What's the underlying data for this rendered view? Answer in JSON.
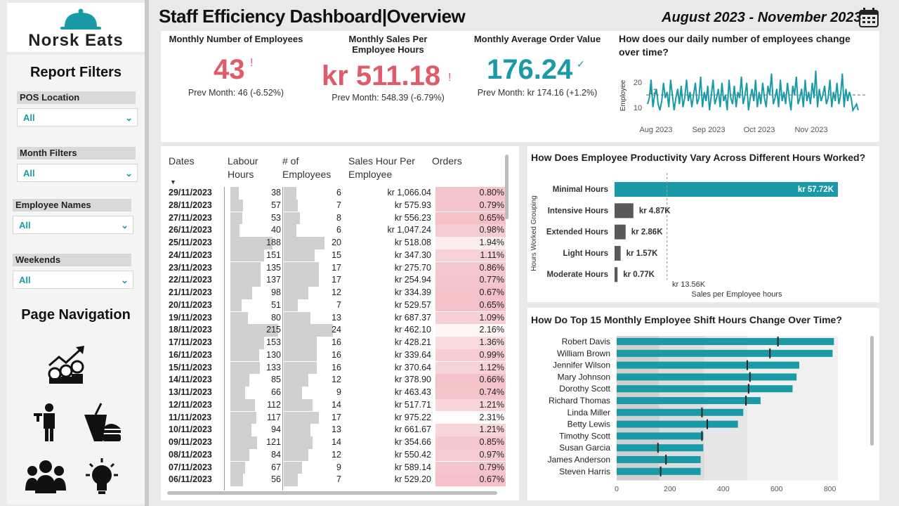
{
  "logo": {
    "brand": "Norsk Eats"
  },
  "sidebar": {
    "report_filters_title": "Report Filters",
    "filters": [
      {
        "label": "POS Location",
        "value": "All"
      },
      {
        "label": "Month Filters",
        "value": "All"
      },
      {
        "label": "Employee Names",
        "value": "All"
      },
      {
        "label": "Weekends",
        "value": "All"
      }
    ],
    "page_navigation_title": "Page Navigation",
    "nav_icons": [
      "sales-growth-icon",
      "waiter-icon",
      "food-menu-icon",
      "team-icon",
      "idea-icon"
    ]
  },
  "header": {
    "title": "Staff Efficiency Dashboard|Overview",
    "date_range": "August 2023 - November 2023",
    "date_icon": "calendar-icon"
  },
  "kpis": [
    {
      "label": "Monthly Number of Employees",
      "value": "43",
      "indicator": "!",
      "sub": "Prev Month: 46 (-6.52%)",
      "color": "#e05b6a"
    },
    {
      "label": "Monthly Sales Per Employee Hours",
      "value": "kr 511.18",
      "indicator": "!",
      "sub": "Prev Month: 548.39 (-6.79%)",
      "color": "#e05b6a"
    },
    {
      "label": "Monthly Average Order Value",
      "value": "176.24",
      "indicator": "✓",
      "sub": "Prev Month: kr 174.16 (+1.2%)",
      "color": "#1a9aa6"
    }
  ],
  "daily_employees_chart": {
    "title": "How does our daily number of employees change over time?",
    "ylabel": "Employee",
    "y_ticks": [
      "20",
      "10"
    ],
    "avg_label": "13",
    "x_ticks": [
      "Aug 2023",
      "Sep 2023",
      "Oct 2023",
      "Nov 2023"
    ],
    "accent": "#1a9aa6",
    "chart_data": {
      "type": "line",
      "ylim": [
        5,
        22
      ],
      "average": 13,
      "values": [
        10,
        12,
        18,
        9,
        13,
        15,
        10,
        8,
        11,
        17,
        12,
        14,
        9,
        18,
        13,
        8,
        12,
        15,
        10,
        16,
        9,
        12,
        18,
        11,
        14,
        9,
        13,
        17,
        10,
        12,
        19,
        9,
        14,
        11,
        16,
        8,
        13,
        18,
        10,
        12,
        15,
        9,
        17,
        11,
        13,
        8,
        18,
        12,
        10,
        16,
        9,
        14,
        12,
        19,
        10,
        13,
        17,
        8,
        12,
        15,
        11,
        18,
        9,
        14,
        10,
        17,
        12,
        9,
        16,
        13,
        20,
        10,
        12,
        15,
        9,
        18,
        11,
        14,
        10,
        17,
        12,
        8,
        16,
        13,
        19,
        10,
        12,
        15,
        9,
        18,
        11,
        14,
        10,
        17,
        12,
        21,
        9,
        15,
        11,
        13,
        16,
        10,
        12,
        18,
        9,
        14,
        11,
        17,
        10,
        13,
        20,
        9,
        15,
        11,
        14,
        12,
        8,
        9,
        10,
        8
      ]
    }
  },
  "table": {
    "headers": [
      "Dates",
      "Labour Hours",
      "# of Employees",
      "Sales Hour Per Employee",
      "Orders"
    ],
    "rows": [
      {
        "date": "29/11/2023",
        "hours": "38",
        "emps": "6",
        "sales": "kr 1,066.04",
        "orders": "0.80%"
      },
      {
        "date": "28/11/2023",
        "hours": "57",
        "emps": "7",
        "sales": "kr 575.93",
        "orders": "0.79%"
      },
      {
        "date": "27/11/2023",
        "hours": "53",
        "emps": "8",
        "sales": "kr 556.23",
        "orders": "0.65%"
      },
      {
        "date": "26/11/2023",
        "hours": "40",
        "emps": "6",
        "sales": "kr 1,047.24",
        "orders": "0.98%"
      },
      {
        "date": "25/11/2023",
        "hours": "188",
        "emps": "20",
        "sales": "kr 518.08",
        "orders": "1.94%"
      },
      {
        "date": "24/11/2023",
        "hours": "151",
        "emps": "15",
        "sales": "kr 347.30",
        "orders": "1.11%"
      },
      {
        "date": "23/11/2023",
        "hours": "135",
        "emps": "17",
        "sales": "kr 275.70",
        "orders": "0.86%"
      },
      {
        "date": "22/11/2023",
        "hours": "137",
        "emps": "17",
        "sales": "kr 254.94",
        "orders": "0.77%"
      },
      {
        "date": "21/11/2023",
        "hours": "98",
        "emps": "12",
        "sales": "kr 334.39",
        "orders": "0.67%"
      },
      {
        "date": "20/11/2023",
        "hours": "51",
        "emps": "7",
        "sales": "kr 529.57",
        "orders": "0.65%"
      },
      {
        "date": "19/11/2023",
        "hours": "80",
        "emps": "13",
        "sales": "kr 687.37",
        "orders": "1.09%"
      },
      {
        "date": "18/11/2023",
        "hours": "215",
        "emps": "24",
        "sales": "kr 462.10",
        "orders": "2.16%"
      },
      {
        "date": "17/11/2023",
        "hours": "153",
        "emps": "16",
        "sales": "kr 428.21",
        "orders": "1.36%"
      },
      {
        "date": "16/11/2023",
        "hours": "130",
        "emps": "16",
        "sales": "kr 339.64",
        "orders": "0.99%"
      },
      {
        "date": "15/11/2023",
        "hours": "133",
        "emps": "16",
        "sales": "kr 370.64",
        "orders": "1.12%"
      },
      {
        "date": "14/11/2023",
        "hours": "85",
        "emps": "12",
        "sales": "kr 378.90",
        "orders": "0.66%"
      },
      {
        "date": "13/11/2023",
        "hours": "66",
        "emps": "9",
        "sales": "kr 463.43",
        "orders": "0.74%"
      },
      {
        "date": "12/11/2023",
        "hours": "112",
        "emps": "14",
        "sales": "kr 517.71",
        "orders": "1.21%"
      },
      {
        "date": "11/11/2023",
        "hours": "117",
        "emps": "17",
        "sales": "kr 975.22",
        "orders": "2.31%"
      },
      {
        "date": "10/11/2023",
        "hours": "94",
        "emps": "13",
        "sales": "kr 661.67",
        "orders": "1.21%"
      },
      {
        "date": "09/11/2023",
        "hours": "121",
        "emps": "14",
        "sales": "kr 354.66",
        "orders": "0.85%"
      },
      {
        "date": "08/11/2023",
        "hours": "84",
        "emps": "12",
        "sales": "kr 550.42",
        "orders": "0.97%"
      },
      {
        "date": "07/11/2023",
        "hours": "67",
        "emps": "9",
        "sales": "kr 589.14",
        "orders": "0.79%"
      },
      {
        "date": "06/11/2023",
        "hours": "56",
        "emps": "7",
        "sales": "kr 529.20",
        "orders": "0.67%"
      }
    ],
    "bar_color": "#cfcfcf",
    "heat_color": "#e05b6a"
  },
  "productivity_chart": {
    "title": "How Does Employee Productivity Vary Across Different Hours Worked?",
    "ylabel": "Hours Worked Grouping",
    "xlabel": "Sales per Employee hours",
    "ref_label": "kr 13.56K",
    "bars": [
      {
        "label": "Minimal Hours",
        "value_label": "kr 57.72K",
        "value": 57.72
      },
      {
        "label": "Intensive Hours",
        "value_label": "kr 4.87K",
        "value": 4.87
      },
      {
        "label": "Extended Hours",
        "value_label": "kr 2.86K",
        "value": 2.86
      },
      {
        "label": "Light Hours",
        "value_label": "kr 1.57K",
        "value": 1.57
      },
      {
        "label": "Moderate Hours",
        "value_label": "kr 0.77K",
        "value": 0.77
      }
    ],
    "reference": 13.56,
    "top_color": "#1a9aa6",
    "other_color": "#595959"
  },
  "shift_chart": {
    "title": "How Do Top 15 Monthly Employee Shift Hours Change Over Time?",
    "x_ticks": [
      "0",
      "200",
      "400",
      "600",
      "800"
    ],
    "bar_color": "#1a9aa6",
    "chart_data": {
      "type": "bar",
      "xlim": [
        0,
        830
      ],
      "bands": [
        160,
        330,
        490
      ],
      "rows": [
        {
          "name": "Robert Davis",
          "value": 815,
          "target": 605
        },
        {
          "name": "William Brown",
          "value": 810,
          "target": 575
        },
        {
          "name": "Jennifer Wilson",
          "value": 685,
          "target": 490
        },
        {
          "name": "Mary Johnson",
          "value": 675,
          "target": 500
        },
        {
          "name": "Dorothy Scott",
          "value": 660,
          "target": 495
        },
        {
          "name": "Richard Thomas",
          "value": 540,
          "target": 485
        },
        {
          "name": "Linda Miller",
          "value": 475,
          "target": 320
        },
        {
          "name": "Betty Lewis",
          "value": 455,
          "target": 340
        },
        {
          "name": "Timothy Scott",
          "value": 325,
          "target": 320
        },
        {
          "name": "Susan Garcia",
          "value": 325,
          "target": 155
        },
        {
          "name": "James Anderson",
          "value": 315,
          "target": 185
        },
        {
          "name": "Steven Harris",
          "value": 315,
          "target": 165
        }
      ]
    }
  }
}
